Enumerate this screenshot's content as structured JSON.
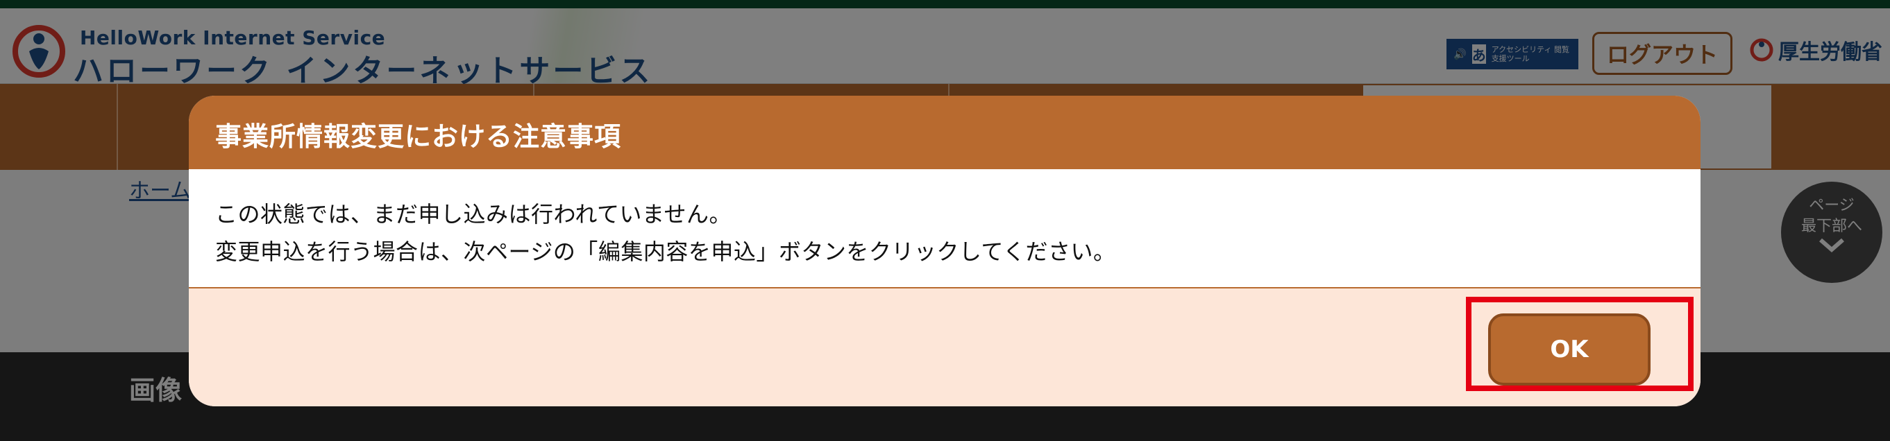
{
  "header": {
    "logo_en": "HelloWork Internet Service",
    "logo_jp": "ハローワーク インターネットサービス",
    "accessibility_mark": "あ",
    "accessibility_label": "アクセシビリティ 閲覧支援ツール",
    "logout_label": "ログアウト",
    "ministry_label": "厚生労働省"
  },
  "breadcrumb": {
    "home": "ホーム"
  },
  "page_bottom": {
    "line1": "ページ",
    "line2": "最下部へ"
  },
  "section": {
    "title_partial": "画像"
  },
  "modal": {
    "title": "事業所情報変更における注意事項",
    "message_line1": "この状態では、まだ申し込みは行われていません。",
    "message_line2": "変更申込を行う場合は、次ページの「編集内容を申込」ボタンをクリックしてください。",
    "ok_label": "OK"
  },
  "colors": {
    "brand_orange": "#b86a2f",
    "brand_blue": "#1f4f86",
    "footer_bg": "#fde6d8",
    "highlight_red": "#e50012"
  }
}
